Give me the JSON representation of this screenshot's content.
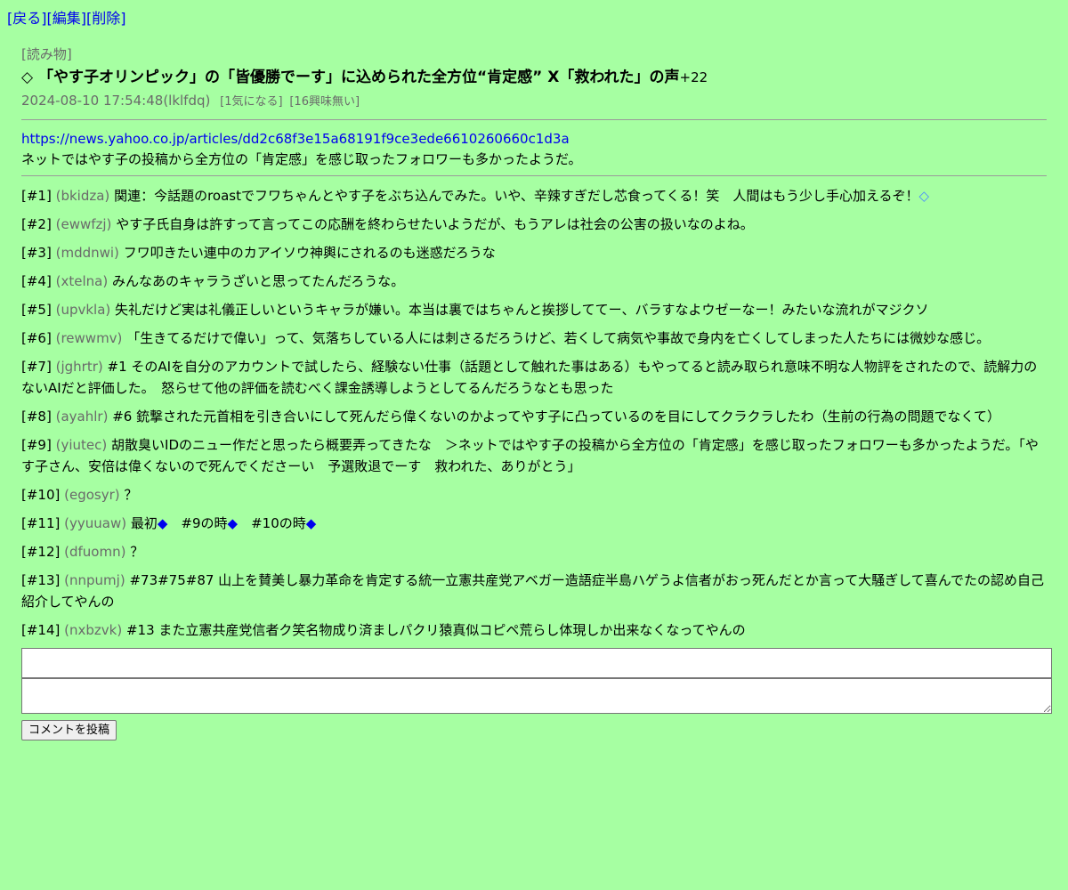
{
  "nav": {
    "back": "[戻る]",
    "edit": "[編集]",
    "delete": "[削除]"
  },
  "post": {
    "category": "[読み物]",
    "title_marker": "◇",
    "title": "「やす子オリンピック」の「皆優勝でーす」に込められた全方位“肯定感” X「救われた」の声",
    "score": "+22",
    "datetime": "2024-08-10 17:54:48",
    "author": "(lklfdq)",
    "interested": "[1気になる]",
    "not_interested": "[16興味無い]",
    "url": "https://news.yahoo.co.jp/articles/dd2c68f3e15a68191f9ce3ede6610260660c1d3a",
    "summary": "ネットではやす子の投稿から全方位の「肯定感」を感じ取ったフォロワーも多かったようだ。"
  },
  "comments": [
    {
      "num": "[#1]",
      "uid": "(bkidza)",
      "text": "関連：今話題のroastでフワちゃんとやす子をぶち込んでみた。いや、辛辣すぎだし芯食ってくる！笑　人間はもう少し手心加えるぞ！",
      "tail": "◇"
    },
    {
      "num": "[#2]",
      "uid": "(ewwfzj)",
      "text": "やす子氏自身は許すって言ってこの応酬を終わらせたいようだが、もうアレは社会の公害の扱いなのよね。"
    },
    {
      "num": "[#3]",
      "uid": "(mddnwi)",
      "text": "フワ叩きたい連中のカアイソウ神輿にされるのも迷惑だろうな"
    },
    {
      "num": "[#4]",
      "uid": "(xtelna)",
      "text": "みんなあのキャラうざいと思ってたんだろうな。"
    },
    {
      "num": "[#5]",
      "uid": "(upvkla)",
      "text": "失礼だけど実は礼儀正しいというキャラが嫌い。本当は裏ではちゃんと挨拶しててー、バラすなよウゼーなー！みたいな流れがマジクソ"
    },
    {
      "num": "[#6]",
      "uid": "(rewwmv)",
      "text": "「生きてるだけで偉い」って、気落ちしている人には刺さるだろうけど、若くして病気や事故で身内を亡くしてしまった人たちには微妙な感じ。"
    },
    {
      "num": "[#7]",
      "uid": "(jghrtr)",
      "text": "#1 そのAIを自分のアカウントで試したら、経験ない仕事（話題として触れた事はある）もやってると読み取られ意味不明な人物評をされたので、読解力のないAIだと評価した。　怒らせて他の評価を読むべく課金誘導しようとしてるんだろうなとも思った"
    },
    {
      "num": "[#8]",
      "uid": "(ayahlr)",
      "text": "#6 銃撃された元首相を引き合いにして死んだら偉くないのかよってやす子に凸っているのを目にしてクラクラしたわ（生前の行為の問題でなくて）"
    },
    {
      "num": "[#9]",
      "uid": "(yiutec)",
      "text": "胡散臭いIDのニュー作だと思ったら概要弄ってきたな　＞ネットではやす子の投稿から全方位の「肯定感」を感じ取ったフォロワーも多かったようだ。「やす子さん、安倍は偉くないので死んでくださーい　予選敗退でーす　救われた、ありがとう」"
    },
    {
      "num": "[#10]",
      "uid": "(egosyr)",
      "text": "？"
    },
    {
      "num": "[#11]",
      "uid": "(yyuuaw)",
      "parts": [
        "最初",
        "◆",
        "　#9の時",
        "◆",
        "　#10の時",
        "◆"
      ]
    },
    {
      "num": "[#12]",
      "uid": "(dfuomn)",
      "text": "？"
    },
    {
      "num": "[#13]",
      "uid": "(nnpumj)",
      "text": "#73#75#87 山上を賛美し暴力革命を肯定する統一立憲共産党アベガー造語症半島ハゲうよ信者がおっ死んだとか言って大騒ぎして喜んでたの認め自己紹介してやんの"
    },
    {
      "num": "[#14]",
      "uid": "(nxbzvk)",
      "text": "#13 また立憲共産党信者ク笑名物成り済ましパクリ猿真似コピペ荒らし体現しか出来なくなってやんの"
    }
  ],
  "form": {
    "submit_label": "コメントを投稿"
  }
}
